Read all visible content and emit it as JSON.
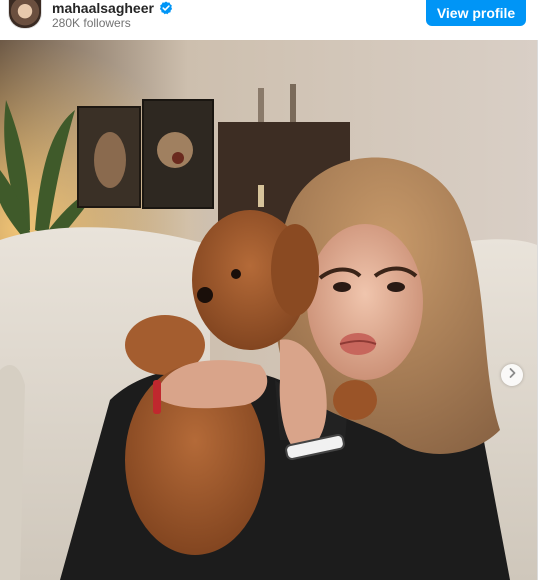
{
  "header": {
    "username": "mahaalsagheer",
    "verified": true,
    "followers": "280K followers",
    "view_profile_label": "View profile"
  },
  "post": {
    "image_alt": "",
    "has_next": true
  },
  "colors": {
    "accent": "#0095f6",
    "verified": "#0095f6",
    "username": "#262626",
    "secondary_text": "#737373"
  },
  "icons": {
    "verified": "verified-badge-icon",
    "next": "chevron-right-icon"
  }
}
